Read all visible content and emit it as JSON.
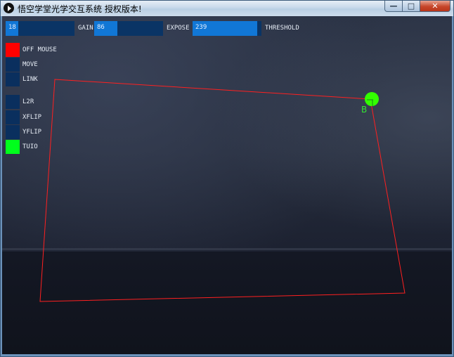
{
  "window": {
    "title": "悟空学堂光学交互系统 授权版本!",
    "buttons": {
      "minimize": "—",
      "maximize": "□",
      "close": "✕"
    }
  },
  "params": [
    {
      "id": "gain",
      "value_text": "18",
      "value": 18,
      "max": 100,
      "label": "GAIN"
    },
    {
      "id": "expose",
      "value_text": "86",
      "value": 86,
      "max": 255,
      "label": "EXPOSE"
    },
    {
      "id": "threshold",
      "value_text": "239",
      "value": 239,
      "max": 255,
      "label": "THRESHOLD"
    }
  ],
  "toggles": [
    {
      "label": "OFF MOUSE",
      "state": "red"
    },
    {
      "label": "MOVE",
      "state": "off"
    },
    {
      "label": "LINK",
      "state": "off"
    },
    {
      "label": "L2R",
      "state": "off"
    },
    {
      "label": "XFLIP",
      "state": "off"
    },
    {
      "label": "YFLIP",
      "state": "off"
    },
    {
      "label": "TUIO",
      "state": "green"
    }
  ],
  "calibration": {
    "point_label": "B",
    "colors": {
      "quad": "#ff2020",
      "point": "#33ff00"
    }
  },
  "colors": {
    "bar_bg": "#0a3465",
    "bar_fill": "#1177d6",
    "toggle_off": "#0a2f5e",
    "toggle_red": "#ff0000",
    "toggle_green": "#00ff1c"
  }
}
